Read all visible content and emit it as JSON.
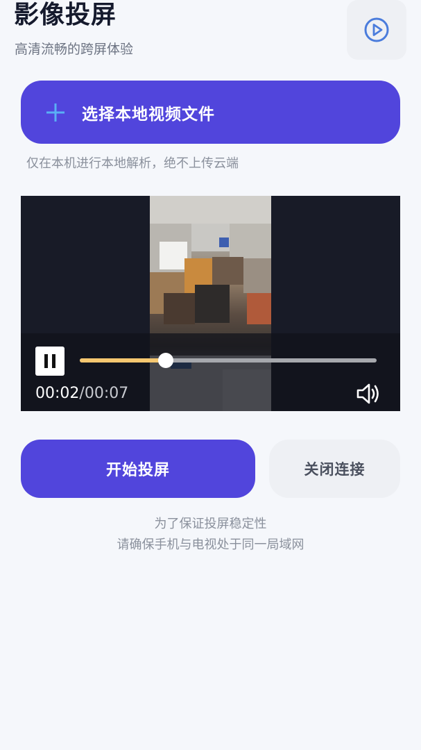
{
  "header": {
    "title": "影像投屏",
    "subtitle": "高清流畅的跨屏体验",
    "play_icon": "play-circle-icon"
  },
  "select_file": {
    "label": "选择本地视频文件",
    "icon": "plus-icon",
    "hint": "仅在本机进行本地解析，绝不上传云端"
  },
  "player": {
    "current_time": "00:02",
    "separator": "/",
    "total_time": "00:07",
    "progress": 0.29,
    "state": "playing",
    "pause_icon": "pause-icon",
    "volume_icon": "volume-icon"
  },
  "actions": {
    "start_label": "开始投屏",
    "close_label": "关闭连接"
  },
  "notes": {
    "line1": "为了保证投屏稳定性",
    "line2": "请确保手机与电视处于同一局域网"
  },
  "colors": {
    "accent": "#5145dc",
    "progress": "#f5c770",
    "plus": "#5ab0f5"
  }
}
